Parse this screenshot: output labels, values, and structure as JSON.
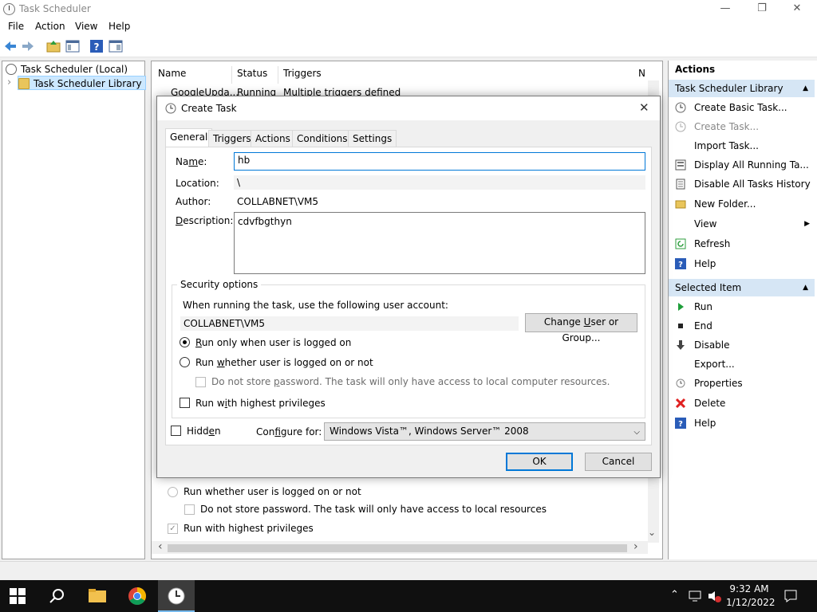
{
  "window": {
    "title": "Task Scheduler",
    "minimize_glyph": "—",
    "maximize_glyph": "❐",
    "close_glyph": "✕"
  },
  "menu": {
    "items": [
      "File",
      "Action",
      "View",
      "Help"
    ]
  },
  "toolbar": {
    "icons": [
      "back-arrow-icon",
      "forward-arrow-icon",
      "up-folder-icon",
      "show-hide-tree-icon",
      "help-icon",
      "show-hide-action-pane-icon"
    ]
  },
  "tree": {
    "root": "Task Scheduler (Local)",
    "library": "Task Scheduler Library",
    "expand_glyph": "›"
  },
  "task_list": {
    "columns": [
      "Name",
      "Status",
      "Triggers",
      "N"
    ],
    "row": {
      "name": "GoogleUpda...",
      "status": "Running",
      "triggers": "Multiple triggers defined"
    },
    "bg_radio_label": "Run whether user is logged on or not",
    "bg_store_label": "Do not store password.  The task will only have access to local resources",
    "bg_highest_label": "Run with highest privileges",
    "check_glyph": "✓",
    "left_arrow": "‹",
    "right_arrow": "›",
    "down_arrow": "⌄"
  },
  "actions_pane": {
    "header": "Actions",
    "section1": "Task Scheduler Library",
    "section2": "Selected Item",
    "collapse_glyph": "▲",
    "submenu_glyph": "▶",
    "items1": [
      "Create Basic Task...",
      "Create Task...",
      "Import Task...",
      "Display All Running Ta...",
      "Disable All Tasks History",
      "New Folder...",
      "View",
      "Refresh",
      "Help"
    ],
    "items2": [
      "Run",
      "End",
      "Disable",
      "Export...",
      "Properties",
      "Delete",
      "Help"
    ]
  },
  "dialog": {
    "title": "Create Task",
    "close_glyph": "✕",
    "tabs": [
      "General",
      "Triggers",
      "Actions",
      "Conditions",
      "Settings"
    ],
    "name_label_pre": "Na",
    "name_label_u": "m",
    "name_label_post": "e:",
    "name_value": "hb",
    "location_label": "Location:",
    "location_value": "\\",
    "author_label": "Author:",
    "author_value": "COLLABNET\\VM5",
    "desc_label_u": "D",
    "desc_label_post": "escription:",
    "desc_value": "cdvfbgthyn",
    "security_title": "Security options",
    "security_prompt": "When running the task, use the following user account:",
    "account": "COLLABNET\\VM5",
    "change_user_pre": "Change ",
    "change_user_u": "U",
    "change_user_post": "ser or Group...",
    "radio1_u": "R",
    "radio1_post": "un only when user is logged on",
    "radio2_pre": "Run ",
    "radio2_u": "w",
    "radio2_post": "hether user is logged on or not",
    "store_pre": "Do not store ",
    "store_u": "p",
    "store_post": "assword.  The task will only have access to local computer resources.",
    "highest_pre": "Run w",
    "highest_u": "i",
    "highest_post": "th highest privileges",
    "hidden_pre": "Hidd",
    "hidden_u": "e",
    "hidden_post": "n",
    "configure_pre": "Con",
    "configure_u": "f",
    "configure_post": "igure for:",
    "configure_value": "Windows Vista™, Windows Server™ 2008",
    "ok": "OK",
    "cancel": "Cancel",
    "chevron_glyph": "⌵"
  },
  "taskbar": {
    "time": "9:32 AM",
    "date": "1/12/2022",
    "tray_up": "⌃"
  },
  "colors": {
    "accent": "#0078d7",
    "section_bg": "#d6e6f5",
    "run_green": "#1e9e3a",
    "delete_red": "#e02020",
    "help_blue": "#2a5cb8"
  }
}
